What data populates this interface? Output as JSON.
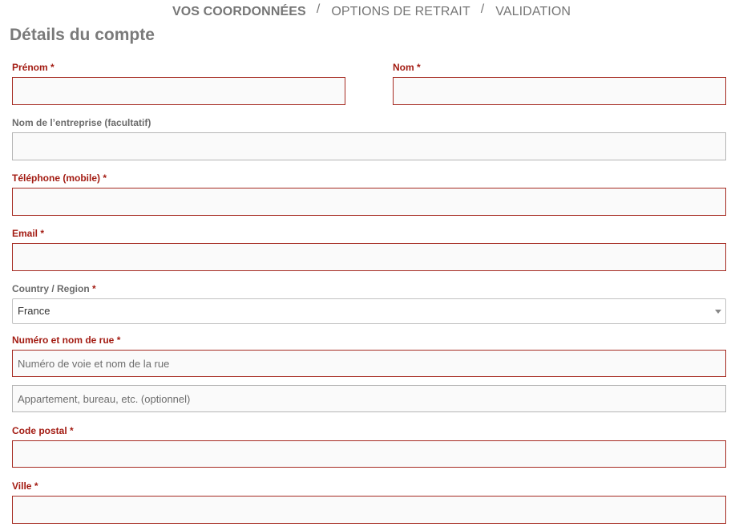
{
  "steps": {
    "items": [
      "VOS COORDONNÉES",
      "OPTIONS DE RETRAIT",
      "VALIDATION"
    ],
    "separator": "/",
    "active_index": 0
  },
  "page_title": "Détails du compte",
  "form": {
    "required_marker": "*",
    "first_name": {
      "label": "Prénom",
      "value": ""
    },
    "last_name": {
      "label": "Nom",
      "value": ""
    },
    "company": {
      "label": "Nom de l’entreprise (facultatif)",
      "value": ""
    },
    "phone": {
      "label": "Téléphone (mobile)",
      "value": ""
    },
    "email": {
      "label": "Email",
      "value": ""
    },
    "country": {
      "label": "Country / Region",
      "selected": "France"
    },
    "street": {
      "label": "Numéro et nom de rue",
      "placeholder_1": "Numéro de voie et nom de la rue",
      "placeholder_2": "Appartement, bureau, etc. (optionnel)"
    },
    "postcode": {
      "label": "Code postal",
      "value": ""
    },
    "city": {
      "label": "Ville",
      "value": ""
    }
  },
  "colors": {
    "required": "#a31b12",
    "field_border": "#a62b22",
    "field_background": "#fafafa",
    "muted_text": "#767676"
  }
}
